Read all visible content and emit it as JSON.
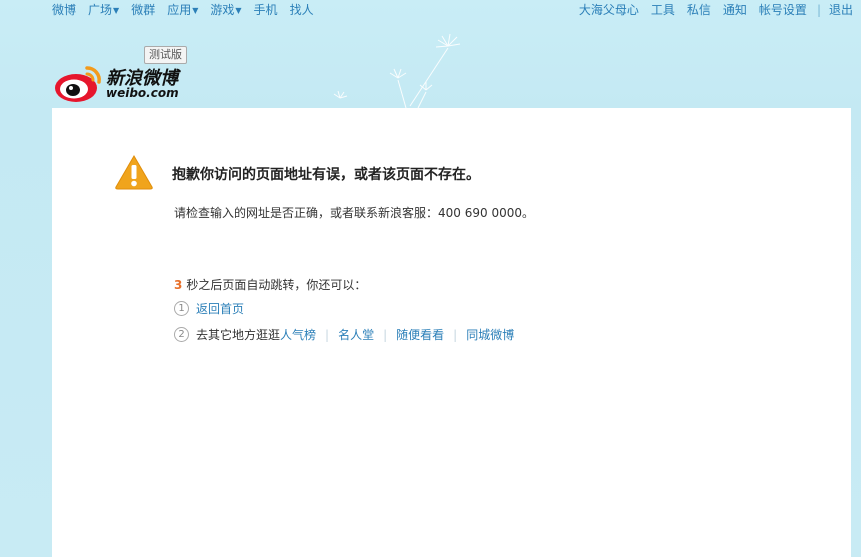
{
  "nav": {
    "left": [
      {
        "label": "微博",
        "dropdown": false
      },
      {
        "label": "广场",
        "dropdown": true
      },
      {
        "label": "微群",
        "dropdown": false
      },
      {
        "label": "应用",
        "dropdown": true
      },
      {
        "label": "游戏",
        "dropdown": true
      },
      {
        "label": "手机",
        "dropdown": false
      },
      {
        "label": "找人",
        "dropdown": false
      }
    ],
    "right": {
      "username": "大海父母心",
      "tools": "工具",
      "messages": "私信",
      "notifications": "通知",
      "account_settings": "帐号设置",
      "separator": "|",
      "logout": "退出"
    }
  },
  "logo": {
    "name_cn": "新浪微博",
    "domain": "weibo.com",
    "beta_badge": "测试版"
  },
  "error": {
    "title": "抱歉你访问的页面地址有误，或者该页面不存在。",
    "description_prefix": "请检查输入的网址是否正确，或者联系新浪客服：",
    "phone": "400 690 0000",
    "description_suffix": "。"
  },
  "redirect": {
    "seconds": "3",
    "text": "秒之后页面自动跳转，你还可以："
  },
  "options": {
    "one": {
      "num": "1",
      "link": "返回首页"
    },
    "two": {
      "num": "2",
      "prefix": "去其它地方逛逛",
      "links": [
        "人气榜",
        "名人堂",
        "随便看看",
        "同城微博"
      ],
      "separator": "|"
    }
  },
  "colors": {
    "background": "#c8ebf4",
    "link": "#2b7fb8",
    "countdown": "#e8702a",
    "warning": "#f0a41c"
  }
}
